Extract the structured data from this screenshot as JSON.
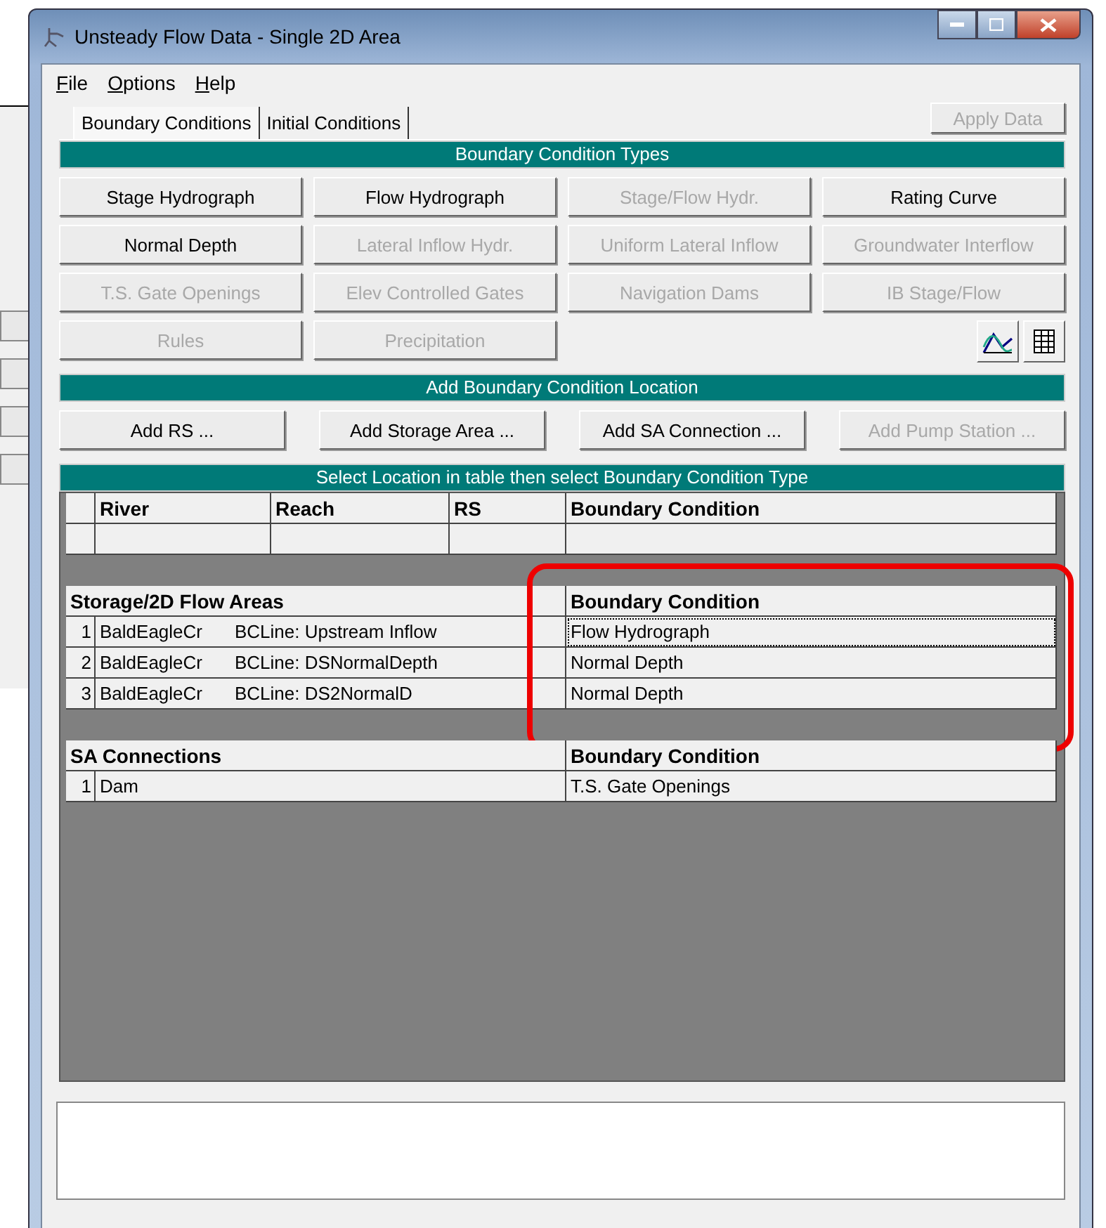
{
  "window": {
    "title": "Unsteady Flow Data - Single 2D Area"
  },
  "menu": [
    {
      "label": "File"
    },
    {
      "label": "Options"
    },
    {
      "label": "Help"
    }
  ],
  "tabs": [
    {
      "label": "Boundary Conditions",
      "selected": true
    },
    {
      "label": "Initial Conditions",
      "selected": false
    }
  ],
  "apply_button": {
    "label": "Apply Data",
    "disabled": true
  },
  "types_panel": {
    "title": "Boundary Condition Types",
    "buttons": [
      {
        "label": "Stage Hydrograph",
        "disabled": false
      },
      {
        "label": "Flow Hydrograph",
        "disabled": false
      },
      {
        "label": "Stage/Flow Hydr.",
        "disabled": true
      },
      {
        "label": "Rating Curve",
        "disabled": false
      },
      {
        "label": "Normal Depth",
        "disabled": false
      },
      {
        "label": "Lateral Inflow Hydr.",
        "disabled": true
      },
      {
        "label": "Uniform Lateral Inflow",
        "disabled": true
      },
      {
        "label": "Groundwater Interflow",
        "disabled": true
      },
      {
        "label": "T.S. Gate Openings",
        "disabled": true
      },
      {
        "label": "Elev Controlled Gates",
        "disabled": true
      },
      {
        "label": "Navigation Dams",
        "disabled": true
      },
      {
        "label": "IB Stage/Flow",
        "disabled": true
      },
      {
        "label": "Rules",
        "disabled": true
      },
      {
        "label": "Precipitation",
        "disabled": true
      }
    ]
  },
  "location_panel": {
    "title": "Add Boundary Condition Location",
    "buttons": [
      {
        "label": "Add RS ...",
        "disabled": false
      },
      {
        "label": "Add Storage Area ...",
        "disabled": false
      },
      {
        "label": "Add SA Connection ...",
        "disabled": false
      },
      {
        "label": "Add Pump Station ...",
        "disabled": true
      }
    ]
  },
  "table": {
    "title": "Select Location in table then select Boundary Condition Type",
    "river_section": {
      "columns": [
        "River",
        "Reach",
        "RS",
        "Boundary Condition"
      ],
      "rows": [
        {
          "cells": [
            "",
            "",
            "",
            ""
          ]
        }
      ]
    },
    "sections": [
      {
        "title": "Storage/2D Flow Areas",
        "bc_header": "Boundary Condition",
        "highlighted": true,
        "rows": [
          {
            "index": "1",
            "name": "BaldEagleCr",
            "line": "BCLine: Upstream Inflow",
            "bc": "Flow Hydrograph",
            "selected": true
          },
          {
            "index": "2",
            "name": "BaldEagleCr",
            "line": "BCLine: DSNormalDepth",
            "bc": "Normal Depth",
            "selected": false
          },
          {
            "index": "3",
            "name": "BaldEagleCr",
            "line": "BCLine: DS2NormalD",
            "bc": "Normal Depth",
            "selected": false
          }
        ]
      },
      {
        "title": "SA Connections",
        "bc_header": "Boundary Condition",
        "rows": [
          {
            "index": "1",
            "name": "Dam",
            "line": "",
            "bc": "T.S. Gate Openings",
            "selected": false
          }
        ]
      }
    ]
  }
}
